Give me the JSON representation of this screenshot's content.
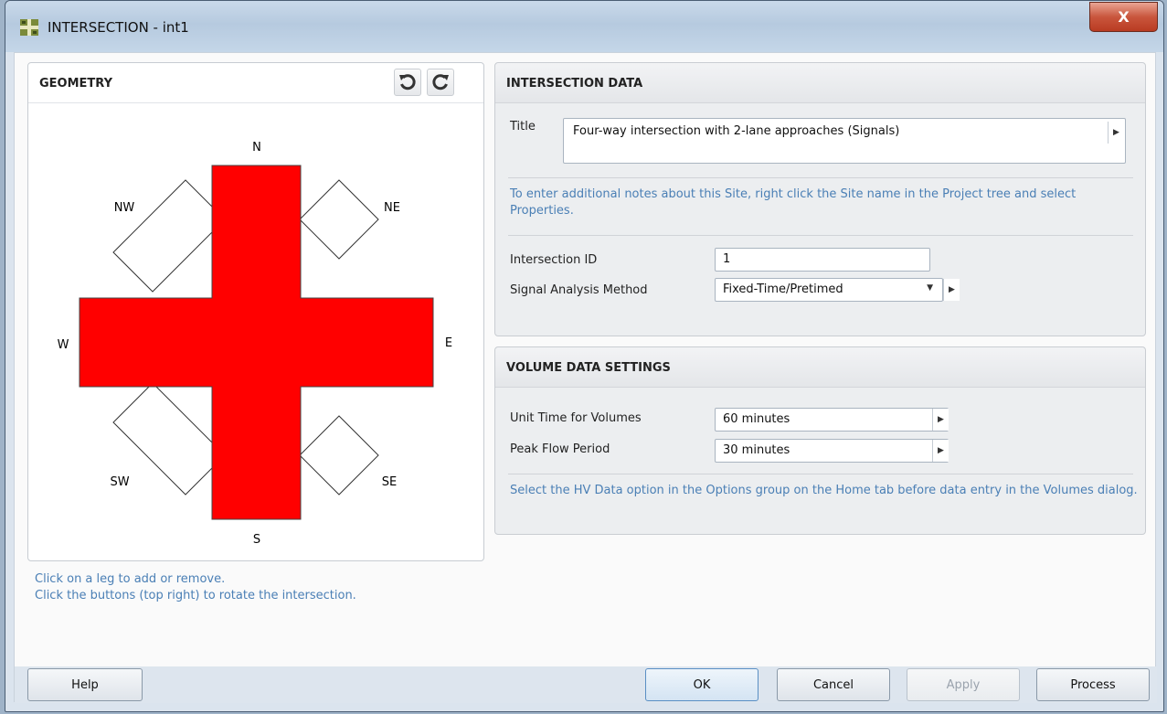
{
  "window": {
    "title": "INTERSECTION - int1",
    "close_label": "X"
  },
  "geometry": {
    "title": "GEOMETRY",
    "legs": {
      "n": "N",
      "ne": "NE",
      "e": "E",
      "se": "SE",
      "s": "S",
      "sw": "SW",
      "w": "W",
      "nw": "NW"
    },
    "active_leg_color": "#ff0000",
    "hint1": "Click on a leg to add or remove.",
    "hint2": "Click the buttons (top right) to rotate the intersection."
  },
  "intersection_data": {
    "title": "INTERSECTION DATA",
    "title_label": "Title",
    "title_value": "Four-way intersection with 2-lane approaches (Signals)",
    "note": "To enter additional notes about this Site, right click the Site name in the Project tree and select Properties.",
    "id_label": "Intersection ID",
    "id_value": "1",
    "method_label": "Signal Analysis Method",
    "method_value": "Fixed-Time/Pretimed"
  },
  "volume_settings": {
    "title": "VOLUME DATA SETTINGS",
    "unit_label": "Unit Time for Volumes",
    "unit_value": "60 minutes",
    "peak_label": "Peak Flow Period",
    "peak_value": "30 minutes",
    "note": "Select the HV Data option in the Options group on the Home tab before data entry in the Volumes dialog."
  },
  "buttons": {
    "help": "Help",
    "ok": "OK",
    "cancel": "Cancel",
    "apply": "Apply",
    "process": "Process"
  }
}
